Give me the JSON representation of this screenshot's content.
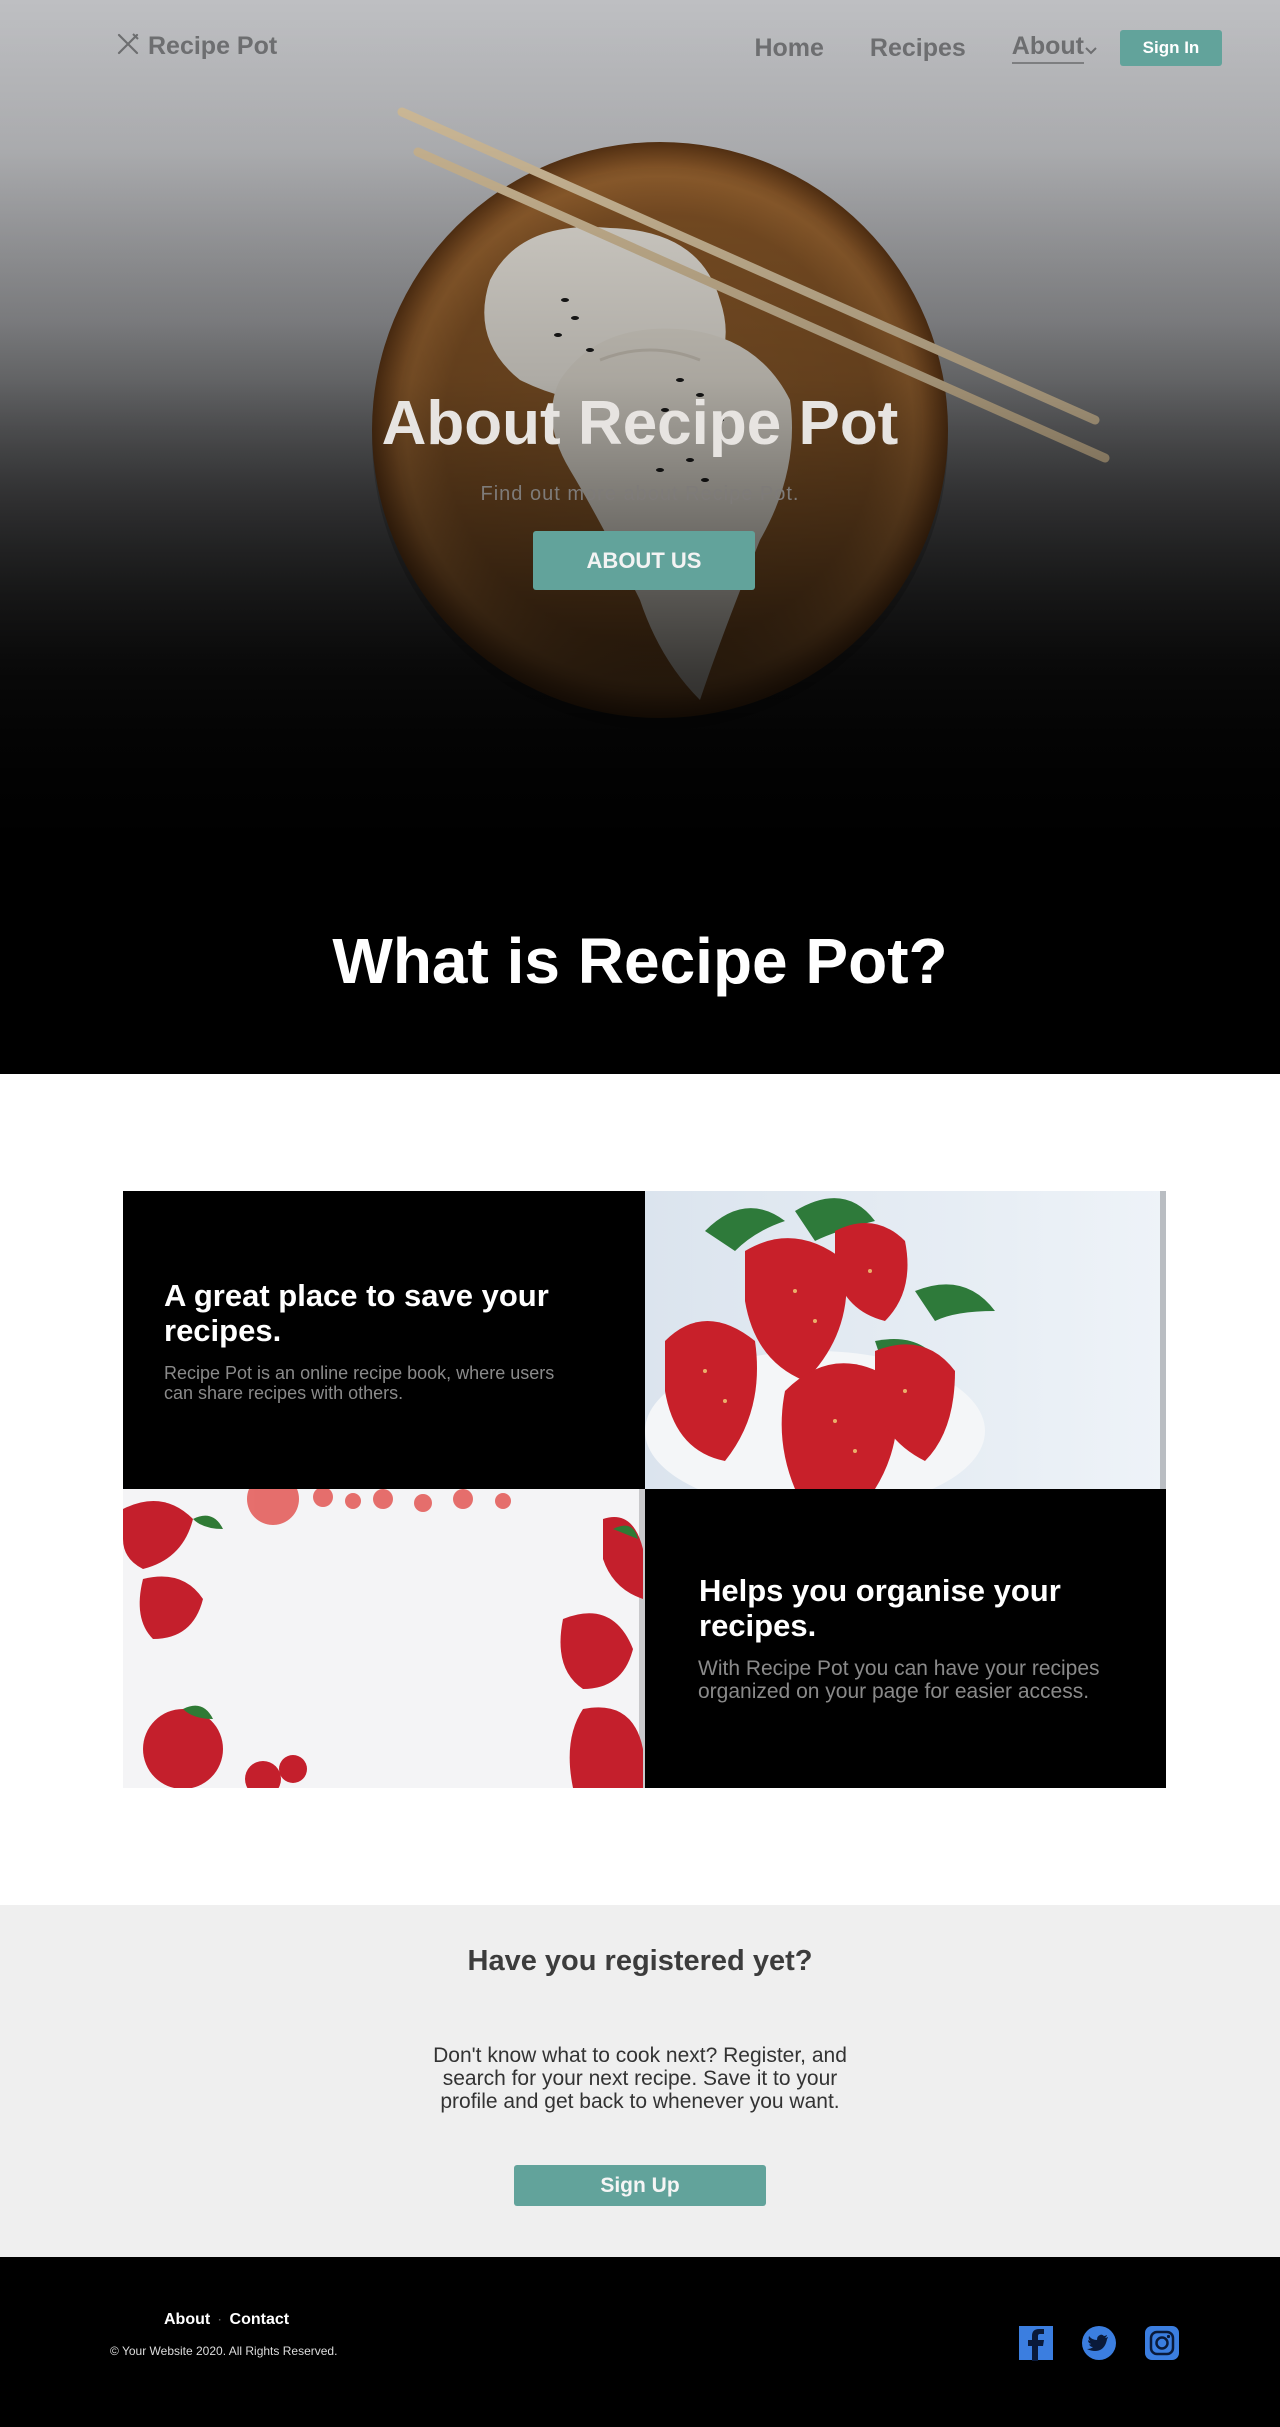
{
  "nav": {
    "brand": "Recipe Pot",
    "links": [
      "Home",
      "Recipes"
    ],
    "about_label": "About",
    "signin_label": "Sign In"
  },
  "hero": {
    "title": "About Recipe Pot",
    "subtitle": "Find out more about Recipe Pot.",
    "button_label": "ABOUT US"
  },
  "what": {
    "heading": "What is Recipe Pot?"
  },
  "features": [
    {
      "title": "A great place to save your recipes.",
      "text": "Recipe Pot is an online recipe book, where users can share recipes with others."
    },
    {
      "title": "Helps you organise your recipes.",
      "text": "With Recipe Pot you can have your recipes organized on your page for easier access."
    }
  ],
  "register": {
    "title": "Have you registered yet?",
    "text": "Don't know what to cook next? Register, and search for your next recipe. Save it to your profile and get back to whenever you want.",
    "button_label": "Sign Up"
  },
  "footer": {
    "links": [
      "About",
      "Contact"
    ],
    "separator": "·",
    "copyright": "© Your Website 2020. All Rights Reserved.",
    "socials": [
      "facebook-icon",
      "twitter-icon",
      "instagram-icon"
    ]
  },
  "colors": {
    "accent": "#62a39b",
    "social_blue": "#3b7ee0"
  }
}
